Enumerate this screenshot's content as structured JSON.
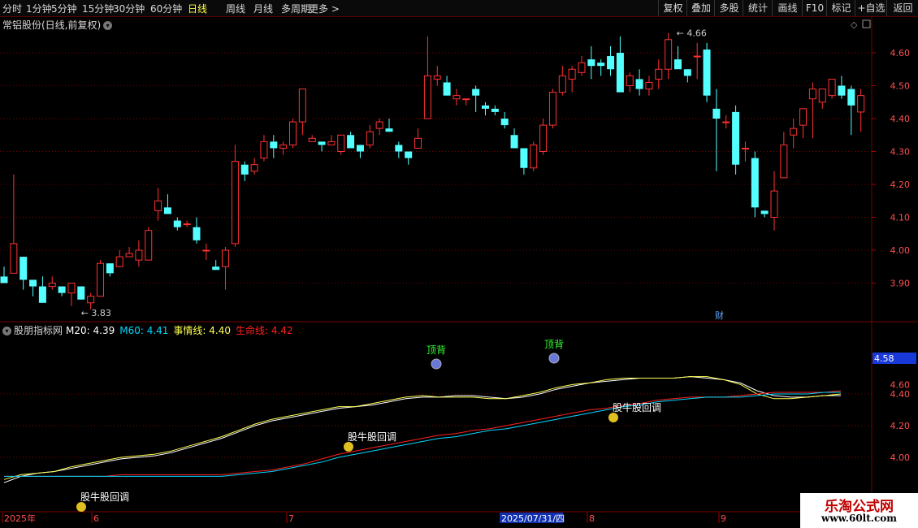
{
  "toolbar": {
    "periods": [
      "分时",
      "1分钟",
      "5分钟",
      "15分钟",
      "30分钟",
      "60分钟",
      "日线",
      "周线",
      "月线",
      "多周期",
      "更多 >"
    ],
    "active_period": "日线",
    "right_buttons": [
      "复权",
      "叠加",
      "多股",
      "统计",
      "画线",
      "F10",
      "标记",
      "+自选",
      "返回"
    ]
  },
  "stock_title": "常铝股份(日线,前复权)",
  "price_axis": [
    "4.60",
    "4.50",
    "4.40",
    "4.30",
    "4.20",
    "4.10",
    "4.00",
    "3.90"
  ],
  "price_annotations": {
    "high_label": "4.66",
    "low_label": "3.83",
    "fin_marker": "财"
  },
  "indicator": {
    "name": "股朋指标网",
    "m20_label": "M20: 4.39",
    "m60_label": "M60: 4.41",
    "event_label": "事情线: 4.40",
    "life_label": "生命线: 4.42",
    "axis": [
      "4.40",
      "4.20",
      "4.00"
    ],
    "axis_clipped": "4.60",
    "current_value": "4.58",
    "signals": [
      {
        "text": "顶背",
        "kind": "top"
      },
      {
        "text": "顶背",
        "kind": "top"
      },
      {
        "text": "股牛股回调",
        "kind": "pullback"
      },
      {
        "text": "股牛股回调",
        "kind": "pullback"
      },
      {
        "text": "股牛股回调",
        "kind": "pullback"
      }
    ]
  },
  "date_axis": {
    "labels": [
      "2025年",
      "6",
      "7",
      "2025/07/31/四",
      "8",
      "9"
    ]
  },
  "watermark": {
    "title": "乐淘公式网",
    "url": "www.60lt.com"
  },
  "colors": {
    "up": "#ff3232",
    "down": "#54ffff",
    "m20": "#ffffff",
    "m60": "#00d8ff",
    "event": "#ffff50",
    "life": "#ff2020",
    "grid": "#7a0000"
  },
  "chart_data": [
    {
      "type": "candlestick",
      "title": "常铝股份(日线,前复权)",
      "ylim": [
        3.83,
        4.66
      ],
      "yticks": [
        3.9,
        4.0,
        4.1,
        4.2,
        4.3,
        4.4,
        4.5,
        4.6
      ],
      "ohlc": [
        [
          3.92,
          3.95,
          3.9,
          3.9
        ],
        [
          3.93,
          4.23,
          3.93,
          4.02
        ],
        [
          3.98,
          3.98,
          3.88,
          3.91
        ],
        [
          3.91,
          3.91,
          3.86,
          3.89
        ],
        [
          3.89,
          3.92,
          3.84,
          3.84
        ],
        [
          3.89,
          3.92,
          3.88,
          3.9
        ],
        [
          3.89,
          3.89,
          3.86,
          3.87
        ],
        [
          3.87,
          3.9,
          3.83,
          3.9
        ],
        [
          3.89,
          3.89,
          3.85,
          3.85
        ],
        [
          3.84,
          3.87,
          3.82,
          3.86
        ],
        [
          3.86,
          3.97,
          3.86,
          3.96
        ],
        [
          3.96,
          3.96,
          3.92,
          3.93
        ],
        [
          3.95,
          4.0,
          3.95,
          3.98
        ],
        [
          3.98,
          4.01,
          3.98,
          3.99
        ],
        [
          3.97,
          4.03,
          3.95,
          4.0
        ],
        [
          3.97,
          4.07,
          3.97,
          4.06
        ],
        [
          4.12,
          4.19,
          4.09,
          4.15
        ],
        [
          4.13,
          4.17,
          4.11,
          4.11
        ],
        [
          4.09,
          4.1,
          4.06,
          4.07
        ],
        [
          4.08,
          4.09,
          4.07,
          4.08
        ],
        [
          4.07,
          4.1,
          4.02,
          4.03
        ],
        [
          4.0,
          4.02,
          3.97,
          4.0
        ],
        [
          3.95,
          3.97,
          3.94,
          3.94
        ],
        [
          3.95,
          4.01,
          3.88,
          4.0
        ],
        [
          4.02,
          4.32,
          4.01,
          4.27
        ],
        [
          4.26,
          4.27,
          4.21,
          4.23
        ],
        [
          4.24,
          4.28,
          4.23,
          4.26
        ],
        [
          4.28,
          4.35,
          4.27,
          4.33
        ],
        [
          4.33,
          4.35,
          4.28,
          4.31
        ],
        [
          4.31,
          4.33,
          4.29,
          4.32
        ],
        [
          4.32,
          4.4,
          4.31,
          4.39
        ],
        [
          4.39,
          4.49,
          4.35,
          4.49
        ],
        [
          4.33,
          4.35,
          4.33,
          4.34
        ],
        [
          4.33,
          4.33,
          4.3,
          4.32
        ],
        [
          4.32,
          4.35,
          4.32,
          4.33
        ],
        [
          4.3,
          4.35,
          4.29,
          4.35
        ],
        [
          4.35,
          4.36,
          4.33,
          4.31
        ],
        [
          4.32,
          4.32,
          4.28,
          4.3
        ],
        [
          4.32,
          4.38,
          4.31,
          4.36
        ],
        [
          4.37,
          4.4,
          4.35,
          4.39
        ],
        [
          4.37,
          4.4,
          4.36,
          4.36
        ],
        [
          4.32,
          4.33,
          4.28,
          4.3
        ],
        [
          4.3,
          4.3,
          4.26,
          4.28
        ],
        [
          4.31,
          4.37,
          4.31,
          4.34
        ],
        [
          4.4,
          4.65,
          4.4,
          4.53
        ],
        [
          4.52,
          4.56,
          4.5,
          4.53
        ],
        [
          4.51,
          4.53,
          4.47,
          4.47
        ],
        [
          4.46,
          4.49,
          4.44,
          4.47
        ],
        [
          4.46,
          4.46,
          4.44,
          4.46
        ],
        [
          4.49,
          4.5,
          4.42,
          4.47
        ],
        [
          4.44,
          4.45,
          4.41,
          4.43
        ],
        [
          4.43,
          4.44,
          4.41,
          4.42
        ],
        [
          4.4,
          4.42,
          4.37,
          4.38
        ],
        [
          4.35,
          4.37,
          4.33,
          4.31
        ],
        [
          4.31,
          4.31,
          4.23,
          4.25
        ],
        [
          4.25,
          4.33,
          4.24,
          4.32
        ],
        [
          4.3,
          4.4,
          4.29,
          4.38
        ],
        [
          4.38,
          4.49,
          4.37,
          4.48
        ],
        [
          4.48,
          4.56,
          4.47,
          4.53
        ],
        [
          4.52,
          4.56,
          4.48,
          4.55
        ],
        [
          4.54,
          4.59,
          4.53,
          4.57
        ],
        [
          4.58,
          4.62,
          4.52,
          4.56
        ],
        [
          4.57,
          4.58,
          4.53,
          4.56
        ],
        [
          4.59,
          4.62,
          4.53,
          4.55
        ],
        [
          4.6,
          4.65,
          4.53,
          4.48
        ],
        [
          4.5,
          4.54,
          4.48,
          4.53
        ],
        [
          4.52,
          4.55,
          4.47,
          4.49
        ],
        [
          4.49,
          4.53,
          4.47,
          4.51
        ],
        [
          4.52,
          4.58,
          4.49,
          4.55
        ],
        [
          4.55,
          4.66,
          4.52,
          4.64
        ],
        [
          4.58,
          4.62,
          4.56,
          4.55
        ],
        [
          4.55,
          4.55,
          4.51,
          4.53
        ],
        [
          4.59,
          4.63,
          4.52,
          4.59
        ],
        [
          4.61,
          4.63,
          4.45,
          4.47
        ],
        [
          4.43,
          4.49,
          4.24,
          4.4
        ],
        [
          4.39,
          4.41,
          4.37,
          4.39
        ],
        [
          4.42,
          4.44,
          4.23,
          4.26
        ],
        [
          4.31,
          4.33,
          4.27,
          4.31
        ],
        [
          4.28,
          4.3,
          4.1,
          4.13
        ],
        [
          4.12,
          4.12,
          4.1,
          4.11
        ],
        [
          4.1,
          4.24,
          4.06,
          4.18
        ],
        [
          4.22,
          4.36,
          4.22,
          4.32
        ],
        [
          4.35,
          4.4,
          4.31,
          4.37
        ],
        [
          4.38,
          4.41,
          4.34,
          4.43
        ],
        [
          4.46,
          4.51,
          4.34,
          4.49
        ],
        [
          4.45,
          4.49,
          4.43,
          4.49
        ],
        [
          4.47,
          4.49,
          4.46,
          4.52
        ],
        [
          4.5,
          4.53,
          4.46,
          4.47
        ],
        [
          4.49,
          4.5,
          4.35,
          4.44
        ],
        [
          4.42,
          4.49,
          4.36,
          4.47
        ]
      ]
    },
    {
      "type": "line",
      "title": "股朋指标网",
      "ylim": [
        3.88,
        4.66
      ],
      "yticks": [
        4.0,
        4.2,
        4.4
      ],
      "series": [
        {
          "name": "M20",
          "values": [
            3.84,
            3.88,
            3.9,
            3.91,
            3.93,
            3.95,
            3.97,
            3.99,
            4.0,
            4.01,
            4.03,
            4.06,
            4.09,
            4.12,
            4.16,
            4.2,
            4.23,
            4.25,
            4.27,
            4.29,
            4.31,
            4.32,
            4.33,
            4.35,
            4.37,
            4.38,
            4.38,
            4.39,
            4.39,
            4.38,
            4.37,
            4.38,
            4.4,
            4.43,
            4.45,
            4.47,
            4.48,
            4.49,
            4.5,
            4.5,
            4.5,
            4.51,
            4.5,
            4.49,
            4.47,
            4.42,
            4.39,
            4.38,
            4.38,
            4.39,
            4.39
          ]
        },
        {
          "name": "事情线",
          "values": [
            3.86,
            3.89,
            3.9,
            3.91,
            3.94,
            3.96,
            3.98,
            4.0,
            4.01,
            4.02,
            4.04,
            4.07,
            4.1,
            4.13,
            4.17,
            4.21,
            4.24,
            4.26,
            4.28,
            4.3,
            4.32,
            4.32,
            4.34,
            4.36,
            4.38,
            4.39,
            4.38,
            4.38,
            4.38,
            4.37,
            4.37,
            4.39,
            4.41,
            4.44,
            4.46,
            4.47,
            4.49,
            4.5,
            4.5,
            4.5,
            4.5,
            4.51,
            4.51,
            4.49,
            4.46,
            4.4,
            4.37,
            4.37,
            4.38,
            4.39,
            4.4
          ]
        },
        {
          "name": "生命线",
          "values": [
            3.88,
            3.88,
            3.88,
            3.88,
            3.88,
            3.88,
            3.88,
            3.89,
            3.89,
            3.89,
            3.89,
            3.89,
            3.89,
            3.89,
            3.9,
            3.91,
            3.92,
            3.94,
            3.96,
            3.99,
            4.02,
            4.04,
            4.06,
            4.08,
            4.1,
            4.12,
            4.14,
            4.15,
            4.17,
            4.18,
            4.2,
            4.22,
            4.24,
            4.26,
            4.28,
            4.3,
            4.31,
            4.33,
            4.34,
            4.36,
            4.37,
            4.38,
            4.38,
            4.38,
            4.39,
            4.4,
            4.41,
            4.41,
            4.41,
            4.41,
            4.42
          ]
        },
        {
          "name": "M60",
          "values": [
            3.88,
            3.88,
            3.88,
            3.88,
            3.88,
            3.88,
            3.88,
            3.88,
            3.88,
            3.88,
            3.88,
            3.88,
            3.88,
            3.88,
            3.89,
            3.9,
            3.91,
            3.93,
            3.95,
            3.97,
            4.0,
            4.02,
            4.04,
            4.06,
            4.08,
            4.1,
            4.12,
            4.13,
            4.15,
            4.17,
            4.18,
            4.2,
            4.22,
            4.24,
            4.26,
            4.28,
            4.3,
            4.32,
            4.33,
            4.35,
            4.36,
            4.37,
            4.38,
            4.38,
            4.38,
            4.39,
            4.4,
            4.4,
            4.4,
            4.41,
            4.41
          ]
        }
      ]
    }
  ]
}
